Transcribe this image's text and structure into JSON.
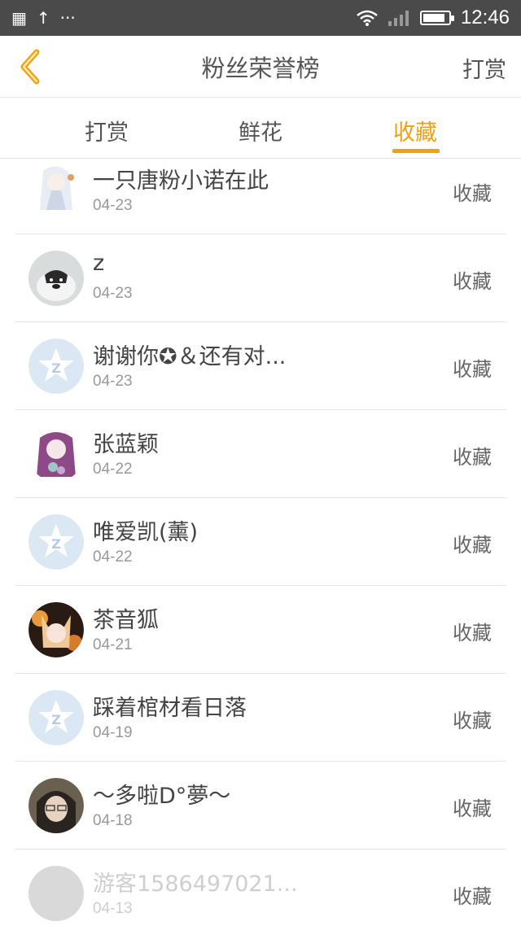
{
  "status_bar": {
    "time": "12:46",
    "battery_level": 0.85
  },
  "nav": {
    "title": "粉丝荣誉榜",
    "action_label": "打赏"
  },
  "tabs": [
    {
      "label": "打赏",
      "active": false
    },
    {
      "label": "鲜花",
      "active": false
    },
    {
      "label": "收藏",
      "active": true
    }
  ],
  "colors": {
    "accent": "#f0a010",
    "text": "#555555",
    "muted": "#999999"
  },
  "fans": [
    {
      "name": "一只唐粉小诺在此",
      "date": "04-23",
      "action": "收藏",
      "avatar": "anime-white-hair"
    },
    {
      "name": "z",
      "date": "04-23",
      "action": "收藏",
      "avatar": "husky"
    },
    {
      "name": "谢谢你✪＆还有对...",
      "date": "04-23",
      "action": "收藏",
      "avatar": "default-star"
    },
    {
      "name": "张蓝颖",
      "date": "04-22",
      "action": "收藏",
      "avatar": "anime-purple-hair"
    },
    {
      "name": "唯爱凯(薰)",
      "date": "04-22",
      "action": "收藏",
      "avatar": "default-star"
    },
    {
      "name": "茶音狐",
      "date": "04-21",
      "action": "收藏",
      "avatar": "anime-fox"
    },
    {
      "name": "踩着棺材看日落",
      "date": "04-19",
      "action": "收藏",
      "avatar": "default-star"
    },
    {
      "name": "～多啦D°夢～",
      "date": "04-18",
      "action": "收藏",
      "avatar": "photo-girl"
    },
    {
      "name": "游客1586497021...",
      "date": "04-13",
      "action": "收藏",
      "avatar": "gray-placeholder"
    }
  ]
}
